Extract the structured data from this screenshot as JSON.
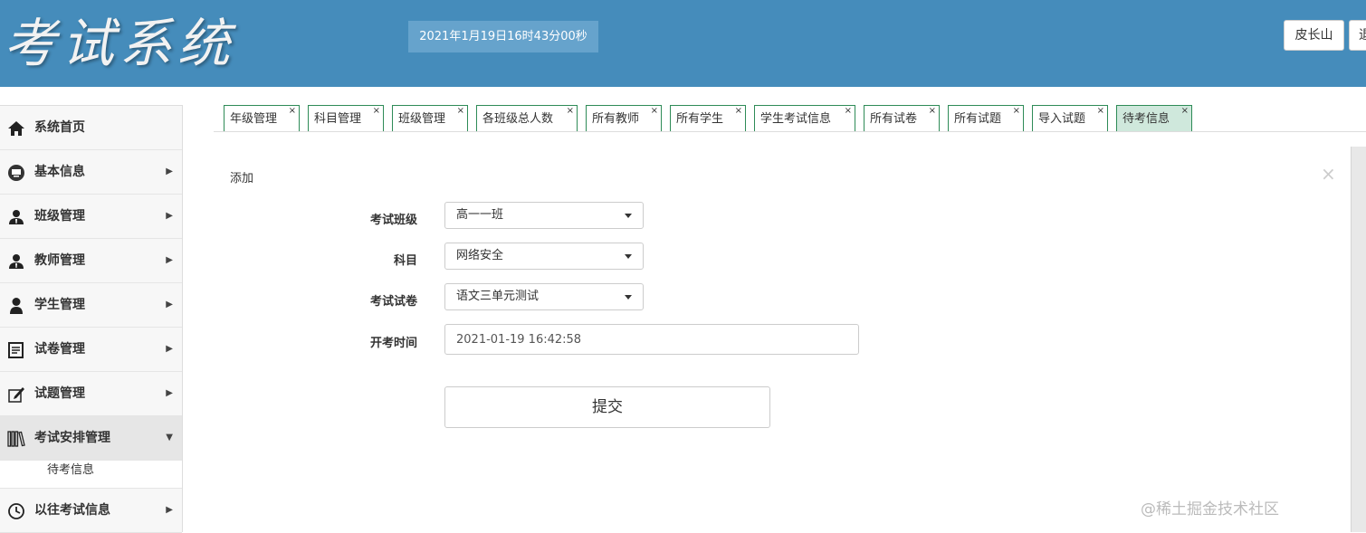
{
  "header": {
    "logo": "考试系统",
    "clock": "2021年1月19日16时43分00秒",
    "user_label": "皮长山",
    "logout_label": "退"
  },
  "sidebar": {
    "items": [
      {
        "label": "系统首页",
        "icon": "home-icon"
      },
      {
        "label": "基本信息",
        "icon": "monitor-icon"
      },
      {
        "label": "班级管理",
        "icon": "user-tie-icon"
      },
      {
        "label": "教师管理",
        "icon": "user-tie-icon"
      },
      {
        "label": "学生管理",
        "icon": "user-icon"
      },
      {
        "label": "试卷管理",
        "icon": "document-icon"
      },
      {
        "label": "试题管理",
        "icon": "edit-icon"
      },
      {
        "label": "考试安排管理",
        "icon": "books-icon"
      },
      {
        "label": "以往考试信息",
        "icon": "clock-icon"
      }
    ],
    "subitem": "待考信息"
  },
  "tabs": [
    {
      "label": "年级管理"
    },
    {
      "label": "科目管理"
    },
    {
      "label": "班级管理"
    },
    {
      "label": "各班级总人数"
    },
    {
      "label": "所有教师"
    },
    {
      "label": "所有学生"
    },
    {
      "label": "学生考试信息"
    },
    {
      "label": "所有试卷"
    },
    {
      "label": "所有试题"
    },
    {
      "label": "导入试题"
    },
    {
      "label": "待考信息"
    }
  ],
  "tab_close": "×",
  "panel": {
    "title": "添加",
    "close": "×"
  },
  "form": {
    "class_label": "考试班级",
    "class_value": "高一一班",
    "subject_label": "科目",
    "subject_value": "网络安全",
    "paper_label": "考试试卷",
    "paper_value": "语文三单元测试",
    "time_label": "开考时间",
    "time_value": "2021-01-19 16:42:58",
    "submit_label": "提交"
  },
  "watermark": "@稀土掘金技术社区",
  "colors": {
    "header_bg": "#458cbb",
    "tab_border": "#2e8b57",
    "active_tab_bg": "#cfe8dc"
  }
}
